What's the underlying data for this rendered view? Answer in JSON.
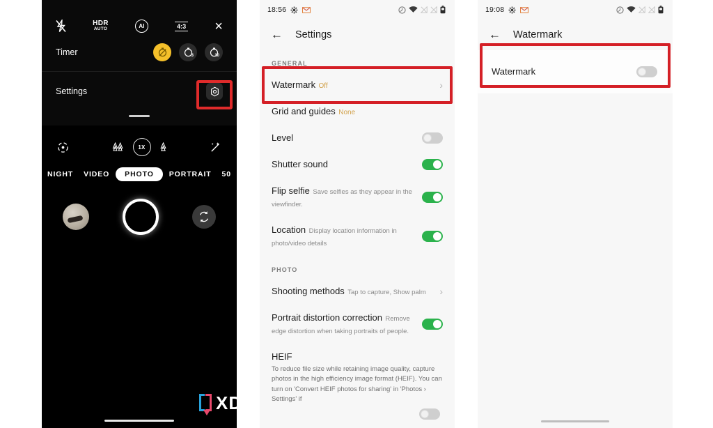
{
  "meta": {
    "layout": "three phone screenshots side by side: camera settings sheet, camera Settings page, Watermark page",
    "accent_red_highlight": "#d41f26",
    "accent_green_toggle": "#2bb24c",
    "accent_amber_value": "#d2a24c"
  },
  "camera_panel": {
    "top_icons": [
      {
        "name": "flash-off-icon",
        "label": ""
      },
      {
        "name": "hdr-auto-icon",
        "label": "HDR",
        "sub": "AUTO"
      },
      {
        "name": "ai-scene-icon",
        "label": "AI"
      },
      {
        "name": "aspect-ratio-icon",
        "label": "4:3"
      },
      {
        "name": "close-icon",
        "label": "×"
      }
    ],
    "timer_row": {
      "label": "Timer",
      "options": [
        {
          "name": "timer-off",
          "value": "off",
          "selected": true
        },
        {
          "name": "timer-3s",
          "value": "3",
          "selected": false
        },
        {
          "name": "timer-10s",
          "value": "10",
          "selected": false
        }
      ]
    },
    "settings_row": {
      "label": "Settings",
      "icon": "gear-icon",
      "highlighted": true
    },
    "lens_row": {
      "left_icon": "focus-reticle-icon",
      "ultrawide_icon": "trees-ultrawide-icon",
      "zoom_label": "1X",
      "wide_icon": "tree-wide-icon",
      "right_icon": "magic-wand-icon"
    },
    "modes": [
      {
        "label": "NIGHT",
        "selected": false,
        "clipped": true
      },
      {
        "label": "VIDEO",
        "selected": false,
        "clipped": false
      },
      {
        "label": "PHOTO",
        "selected": true,
        "clipped": false
      },
      {
        "label": "PORTRAIT",
        "selected": false,
        "clipped": false
      },
      {
        "label": "50",
        "selected": false,
        "clipped": true
      }
    ],
    "shutter_row": {
      "gallery_thumb": "last-photo-thumbnail",
      "shutter": "shutter-button",
      "flip": "flip-camera-icon"
    }
  },
  "settings_panel": {
    "statusbar": {
      "time": "18:56",
      "left_icons": [
        "gear-icon",
        "gmail-icon"
      ],
      "right_icons": [
        "dnd-icon",
        "wifi-icon",
        "signal-1-icon",
        "signal-2-icon",
        "battery-icon"
      ]
    },
    "header": {
      "back": "←",
      "title": "Settings"
    },
    "sections": [
      {
        "title": "GENERAL",
        "items": [
          {
            "label": "Watermark",
            "value": "Off",
            "control": "chevron",
            "highlighted": true
          },
          {
            "label": "Grid and guides",
            "value": "None",
            "control": "none"
          },
          {
            "label": "Level",
            "control": "toggle",
            "toggle": "off"
          },
          {
            "label": "Shutter sound",
            "control": "toggle",
            "toggle": "on"
          },
          {
            "label": "Flip selfie",
            "sub": "Save selfies as they appear in the viewfinder.",
            "control": "toggle",
            "toggle": "on"
          },
          {
            "label": "Location",
            "sub": "Display location information in photo/video details",
            "control": "toggle",
            "toggle": "on"
          }
        ]
      },
      {
        "title": "PHOTO",
        "items": [
          {
            "label": "Shooting methods",
            "sub": "Tap to capture, Show palm",
            "control": "chevron"
          },
          {
            "label": "Portrait distortion correction",
            "sub": "Remove edge distortion when taking portraits of people.",
            "control": "toggle",
            "toggle": "on"
          },
          {
            "label": "HEIF",
            "body": "To reduce file size while retaining image quality, capture photos in the high efficiency image format (HEIF). You can turn on 'Convert HEIF photos for sharing' in 'Photos › Settings' if",
            "control": "toggle",
            "toggle": "off"
          }
        ]
      }
    ]
  },
  "watermark_panel": {
    "statusbar": {
      "time": "19:08",
      "left_icons": [
        "gear-icon",
        "gmail-icon"
      ],
      "right_icons": [
        "dnd-icon",
        "wifi-icon",
        "signal-1-icon",
        "signal-2-icon",
        "battery-icon"
      ]
    },
    "header": {
      "back": "←",
      "title": "Watermark"
    },
    "row": {
      "label": "Watermark",
      "control": "toggle",
      "toggle": "off",
      "highlighted": true
    }
  },
  "watermark_logo": {
    "text": "XDA"
  }
}
